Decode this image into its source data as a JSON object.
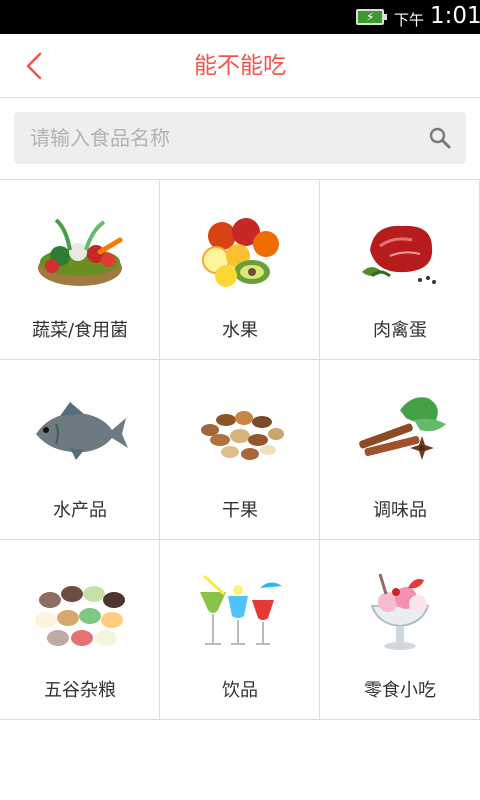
{
  "status_bar": {
    "ampm": "下午",
    "time": "1:01",
    "battery_icon": "battery-charging-icon"
  },
  "header": {
    "title": "能不能吃",
    "back_icon": "back-arrow-icon",
    "accent_color": "#f2554b"
  },
  "search": {
    "placeholder": "请输入食品名称",
    "value": "",
    "icon": "search-icon"
  },
  "categories": [
    {
      "label": "蔬菜/食用菌",
      "icon": "vegetables-basket-icon"
    },
    {
      "label": "水果",
      "icon": "fruit-pile-icon"
    },
    {
      "label": "肉禽蛋",
      "icon": "raw-meat-icon"
    },
    {
      "label": "水产品",
      "icon": "fish-icon"
    },
    {
      "label": "干果",
      "icon": "mixed-nuts-icon"
    },
    {
      "label": "调味品",
      "icon": "spices-icon"
    },
    {
      "label": "五谷杂粮",
      "icon": "grains-icon"
    },
    {
      "label": "饮品",
      "icon": "cocktail-drinks-icon"
    },
    {
      "label": "零食小吃",
      "icon": "ice-cream-sundae-icon"
    }
  ]
}
